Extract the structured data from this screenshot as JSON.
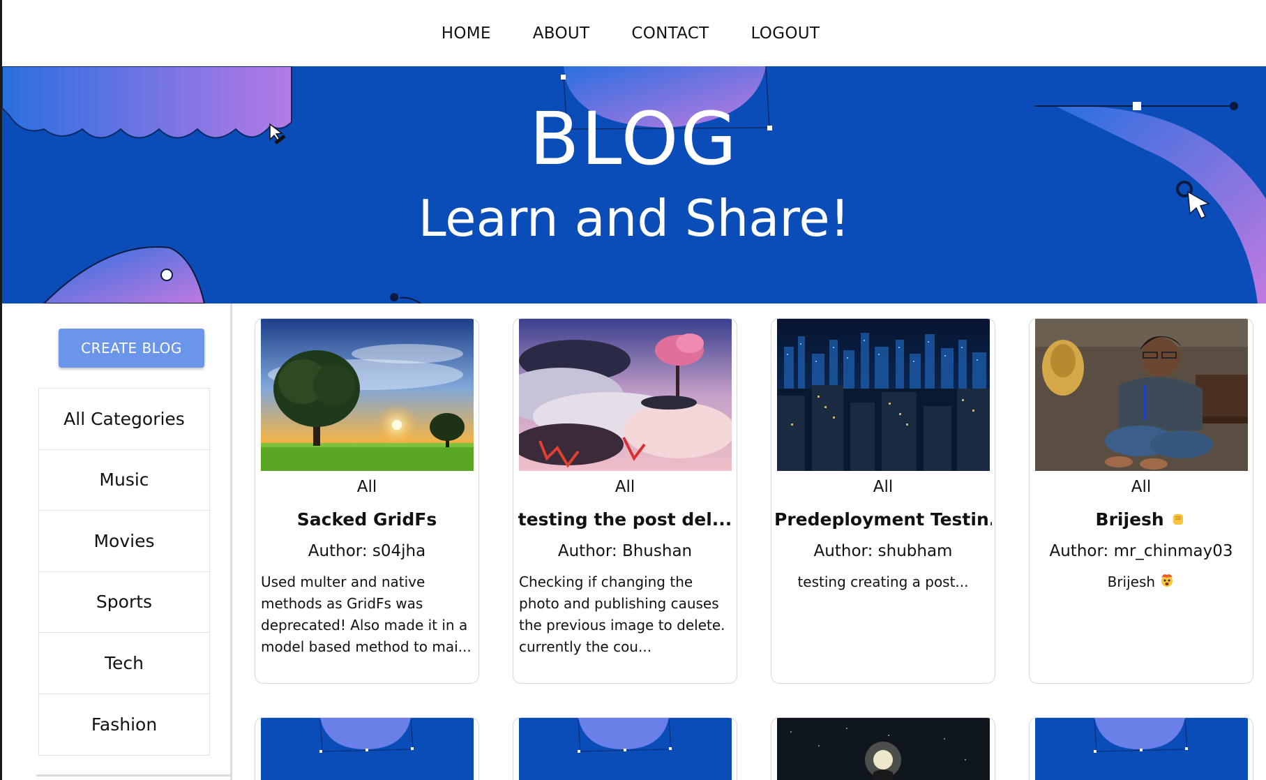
{
  "nav": {
    "links": [
      "HOME",
      "ABOUT",
      "CONTACT",
      "LOGOUT"
    ]
  },
  "hero": {
    "title": "BLOG",
    "subtitle": "Learn and Share!",
    "background_color": "#0a4db8"
  },
  "sidebar": {
    "create_button": "CREATE BLOG",
    "categories": [
      "All Categories",
      "Music",
      "Movies",
      "Sports",
      "Tech",
      "Fashion"
    ]
  },
  "posts": [
    {
      "category": "All",
      "title": "Sacked GridFs",
      "author": "Author: s04jha",
      "description": "Used multer and native methods as GridFs was deprecated! Also made it in a model based method to mai...",
      "image": "tree-sunset"
    },
    {
      "category": "All",
      "title": "testing the post del...",
      "author": "Author: Bhushan",
      "description": "Checking if changing the photo and publishing causes the previous image to delete. currently the cou...",
      "image": "fantasy-clouds"
    },
    {
      "category": "All",
      "title": "Predeployment Testin...",
      "author": "Author: shubham",
      "description": "testing creating a post...",
      "image": "city-night"
    },
    {
      "category": "All",
      "title": "Brijesh",
      "title_emoji": "fist-emoji",
      "author": "Author: mr_chinmay03",
      "description": "Brijesh",
      "description_emoji": "exploding-head-emoji",
      "image": "person-sitting"
    }
  ],
  "second_row_images": [
    "blog-banner",
    "blog-banner",
    "galaxy-night",
    "blog-banner"
  ],
  "colors": {
    "accent_button": "#6a95e8",
    "hero_blue": "#0a4db8"
  }
}
